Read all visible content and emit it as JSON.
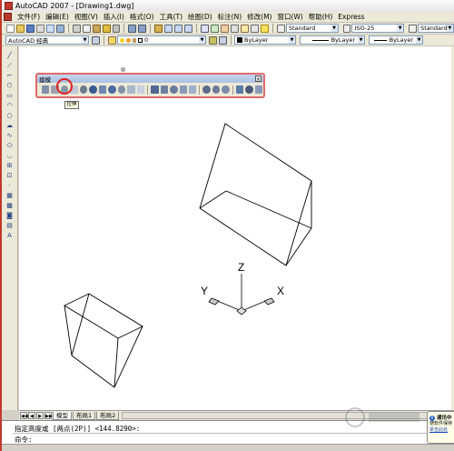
{
  "app": {
    "title": "AutoCAD 2007 - [Drawing1.dwg]"
  },
  "menu": {
    "items": [
      "文件(F)",
      "编辑(E)",
      "视图(V)",
      "插入(I)",
      "格式(O)",
      "工具(T)",
      "绘图(D)",
      "标注(N)",
      "修改(M)",
      "窗口(W)",
      "帮助(H)",
      "Express"
    ]
  },
  "toolbar1": {
    "text_style": "Standard",
    "dim_style": "ISO-25",
    "table_style": "Standard"
  },
  "toolbar2": {
    "workspace": "AutoCAD 经典",
    "layer": "0",
    "color": "ByLayer",
    "linetype": "ByLayer",
    "lineweight": "ByLayer"
  },
  "floating_toolbar": {
    "title": "建模",
    "close_glyph": "×",
    "tooltip": "拉伸"
  },
  "axes": {
    "x": "X",
    "y": "Y",
    "z": "Z"
  },
  "tabs": {
    "model": "模型",
    "layout": "布局1",
    "layout2": "布局2"
  },
  "command": {
    "history": "指定高度或 [两点(2P)] <144.8290>:",
    "prompt": "命令:"
  },
  "notification": {
    "title": "通讯中",
    "line1": "使软件保持",
    "link": "单击此处",
    "icon": "i"
  },
  "colors": {
    "accent_red": "#e02020",
    "titlebar_bg": "#f0f0f0",
    "toolbar_bg": "#ece9d8"
  }
}
